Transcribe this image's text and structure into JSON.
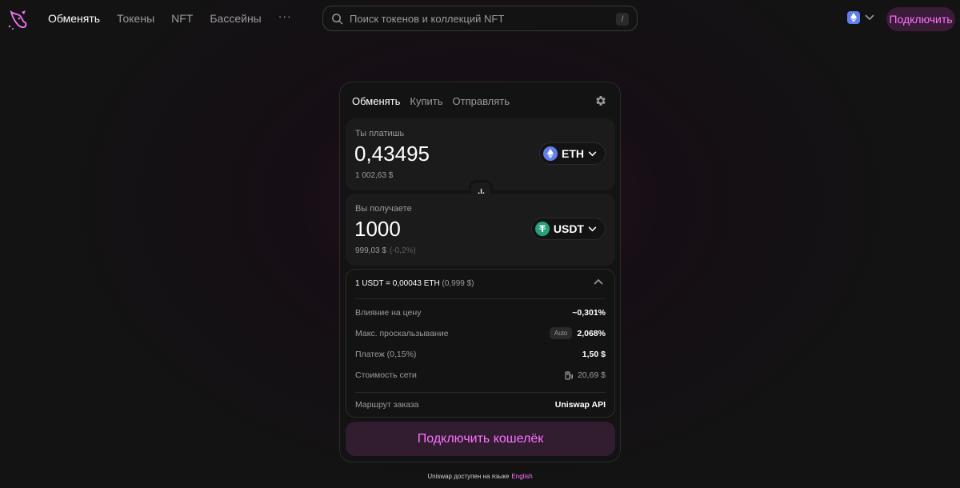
{
  "header": {
    "nav": [
      {
        "label": "Обменять",
        "active": true
      },
      {
        "label": "Токены",
        "active": false
      },
      {
        "label": "NFT",
        "active": false
      },
      {
        "label": "Бассейны",
        "active": false
      }
    ],
    "more_label": "···",
    "search_placeholder": "Поиск токенов и коллекций NFT",
    "search_shortcut": "/",
    "connect_label": "Подключить"
  },
  "swap": {
    "tabs": [
      {
        "label": "Обменять",
        "active": true
      },
      {
        "label": "Купить",
        "active": false
      },
      {
        "label": "Отправлять",
        "active": false
      }
    ],
    "pay": {
      "label": "Ты платишь",
      "amount": "0,43495",
      "usd": "1 002,63 $",
      "token": "ETH"
    },
    "receive": {
      "label": "Вы получаете",
      "amount": "1000",
      "usd": "999,03 $",
      "usd_diff": "(-0,2%)",
      "token": "USDT"
    },
    "details": {
      "rate": "1 USDT = 0,00043 ETH",
      "rate_usd": "(0,999 $)",
      "rows": [
        {
          "key": "Влияние на цену",
          "value": "~0,301%"
        },
        {
          "key": "Макс. проскальзывание",
          "badge": "Auto",
          "value": "2,068%"
        },
        {
          "key": "Платеж (0,15%)",
          "value": "1,50 $"
        },
        {
          "key": "Стоимость сети",
          "value": "20,69 $"
        },
        {
          "key": "Маршрут заказа",
          "value": "Uniswap API"
        }
      ]
    },
    "connect_wallet_label": "Подключить кошелёк"
  },
  "footer": {
    "text": "Uniswap доступен на языке",
    "link": "English"
  },
  "colors": {
    "accent": "#fc72ff",
    "eth": "#627eea",
    "usdt": "#26a17b"
  }
}
